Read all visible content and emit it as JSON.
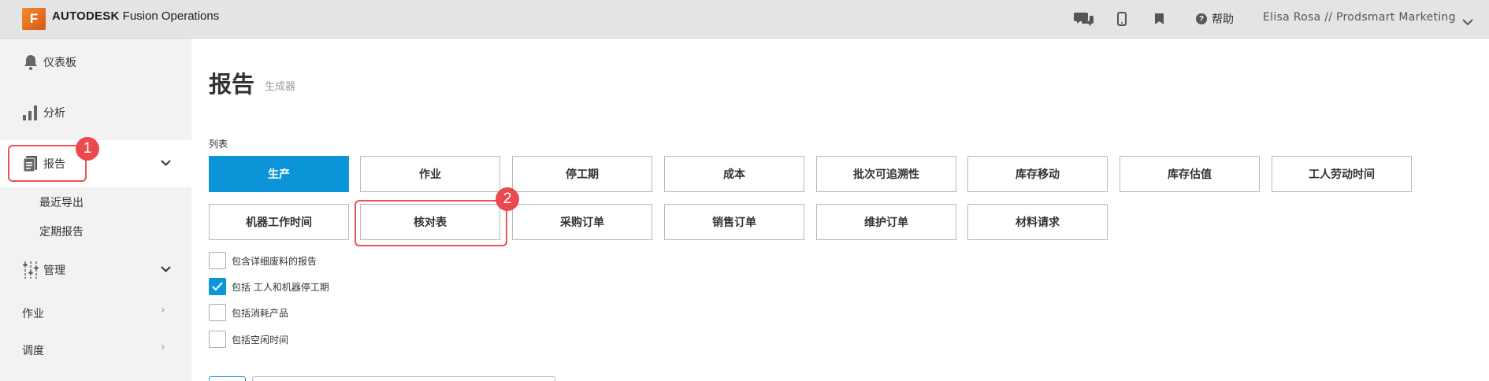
{
  "header": {
    "logo_letter": "F",
    "brand_bold": "AUTODESK",
    "brand_product": "Fusion Operations",
    "help_label": "帮助",
    "user_label": "Elisa Rosa // Prodsmart Marketing",
    "icons": [
      "chat-icon",
      "mobile-icon",
      "bookmark-icon",
      "help-icon",
      "chevron-down-icon"
    ]
  },
  "sidebar": {
    "dashboard": "仪表板",
    "analytics": "分析",
    "reports": "报告",
    "reports_sub": [
      "最近导出",
      "定期报告"
    ],
    "manage": "管理",
    "jobs": "作业",
    "scheduling": "调度",
    "badge_1": "1"
  },
  "main": {
    "title": "报告",
    "subtitle": "生成器",
    "list_label": "列表",
    "report_types_row1": [
      "生产",
      "作业",
      "停工期",
      "成本",
      "批次可追溯性",
      "库存移动",
      "库存估值",
      "工人劳动时间"
    ],
    "report_types_row2": [
      "机器工作时间",
      "核对表",
      "采购订单",
      "销售订单",
      "维护订单",
      "材料请求"
    ],
    "active_type": "生产",
    "badge_2": "2",
    "options": [
      {
        "label": "包含详细废料的报告",
        "checked": false
      },
      {
        "label": "包括 工人和机器停工期",
        "checked": true
      },
      {
        "label": "包括消耗产品",
        "checked": false
      },
      {
        "label": "包括空闲时间",
        "checked": false
      }
    ]
  },
  "colors": {
    "accent": "#0c96d9",
    "highlight": "#e8545a",
    "topbar": "#e4e4e4",
    "sidebar": "#f2f2f2"
  }
}
